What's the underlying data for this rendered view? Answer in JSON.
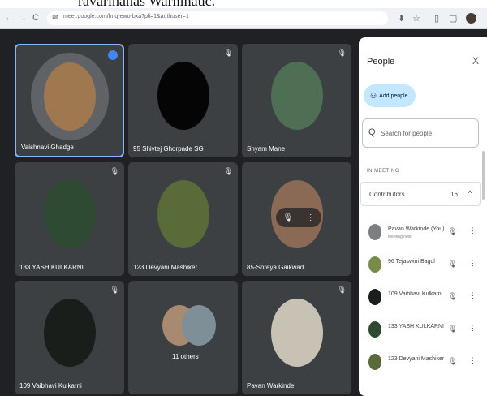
{
  "caption": {
    "text": "ravarinanas Warninauc."
  },
  "browser": {
    "nav_back": "←",
    "nav_forward": "→",
    "nav_reload": "C",
    "tune_icon": "⇌",
    "url": "meet.google.com/hnq-ewo-bxa?pli=1&authuser=1",
    "download_icon": "⬇",
    "star_icon": "☆",
    "tab_icon": "▯",
    "ext_icon": "▢",
    "profile_icon": "avatar"
  },
  "tiles": [
    {
      "name": "Vaishnavi Ghadge",
      "active": true,
      "status_icon": "speaking-dot",
      "avatar_color": "#a07850"
    },
    {
      "name": "95 Shivtej Ghorpade SG",
      "active": false,
      "status_icon": "mic-off",
      "avatar_color": "#050505"
    },
    {
      "name": "Shyam Mane",
      "active": false,
      "status_icon": "mic-off",
      "avatar_color": "#4f6f55"
    },
    {
      "name": "133 YASH KULKARNI",
      "active": false,
      "status_icon": "mic-off",
      "avatar_color": "#2e4a32"
    },
    {
      "name": "123 Devyani Mashiker",
      "active": false,
      "status_icon": "mic-off",
      "avatar_color": "#5a6b3a"
    },
    {
      "name": "85-Shreya Gaikwad",
      "active": false,
      "status_icon": "",
      "avatar_color": "#8a6a55",
      "overlay": {
        "mic": "🎙",
        "more": "⋮"
      }
    },
    {
      "name": "109 Vaibhavi Kulkarni",
      "active": false,
      "status_icon": "mic-off",
      "avatar_color": "#1a1e1a"
    },
    {
      "name": "11 others",
      "active": false,
      "status_icon": "",
      "avatar_color": "#3c4043",
      "others": true
    },
    {
      "name": "Pavan Warkinde",
      "active": false,
      "status_icon": "mic-off",
      "avatar_color": "#c8c2b4"
    }
  ],
  "people_panel": {
    "title": "People",
    "close_icon": "X",
    "add_people_label": "Add people",
    "add_people_icon": "person-add",
    "search_placeholder": "Search for people",
    "search_icon": "Q",
    "section_label": "IN MEETING",
    "contributors_label": "Contributors",
    "contributors_count": "16",
    "chevron_icon": "^",
    "participants": [
      {
        "name": "Pavan Warkinde (You)",
        "subtitle": "Meeting host",
        "avatar_color": "#7b7f80"
      },
      {
        "name": "96 Tejaswini Bagul",
        "subtitle": "",
        "avatar_color": "#7a8a4a"
      },
      {
        "name": "109 Vaibhavi Kulkarni",
        "subtitle": "",
        "avatar_color": "#1a1e1a"
      },
      {
        "name": "133 YASH KULKARNI",
        "subtitle": "",
        "avatar_color": "#2e4a32"
      },
      {
        "name": "123 Devyani Mashiker",
        "subtitle": "",
        "avatar_color": "#5a6b3a"
      }
    ],
    "mic_icon": "mic-off",
    "more_icon": "⋮"
  }
}
